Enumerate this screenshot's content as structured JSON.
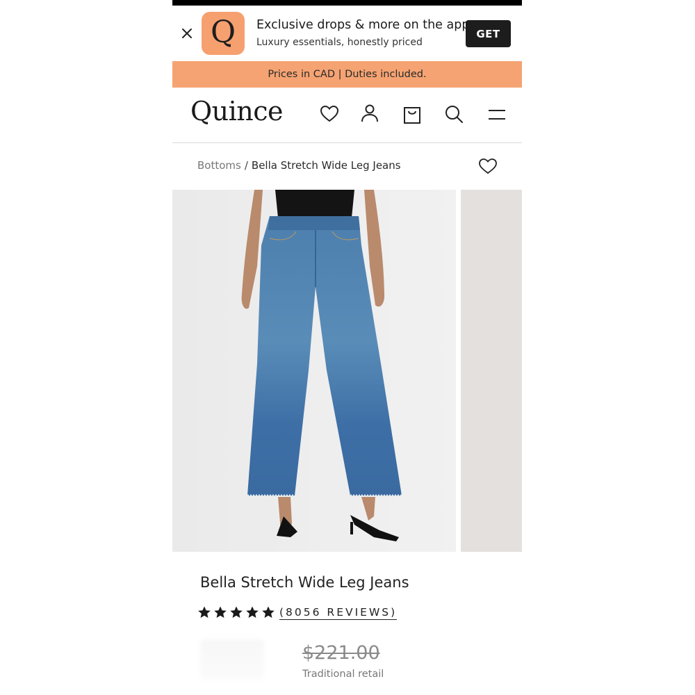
{
  "app_banner": {
    "title": "Exclusive drops & more on the app",
    "subtitle": "Luxury essentials, honestly priced",
    "get_label": "GET",
    "logo_letter": "Q",
    "logo_color": "#f6a06f"
  },
  "promo": {
    "text": "Prices in CAD | Duties included.",
    "color": "#f5a372"
  },
  "header": {
    "brand": "Quince",
    "icons": [
      "heart-icon",
      "account-icon",
      "bag-icon",
      "search-icon",
      "menu-icon"
    ]
  },
  "breadcrumb": {
    "parent": "Bottoms",
    "separator": "/",
    "current": "Bella Stretch Wide Leg Jeans"
  },
  "product": {
    "title": "Bella Stretch Wide Leg Jeans",
    "rating": 5,
    "reviews_label": "(8056 REVIEWS)",
    "traditional_price": "$221.00",
    "traditional_label": "Traditional retail"
  }
}
